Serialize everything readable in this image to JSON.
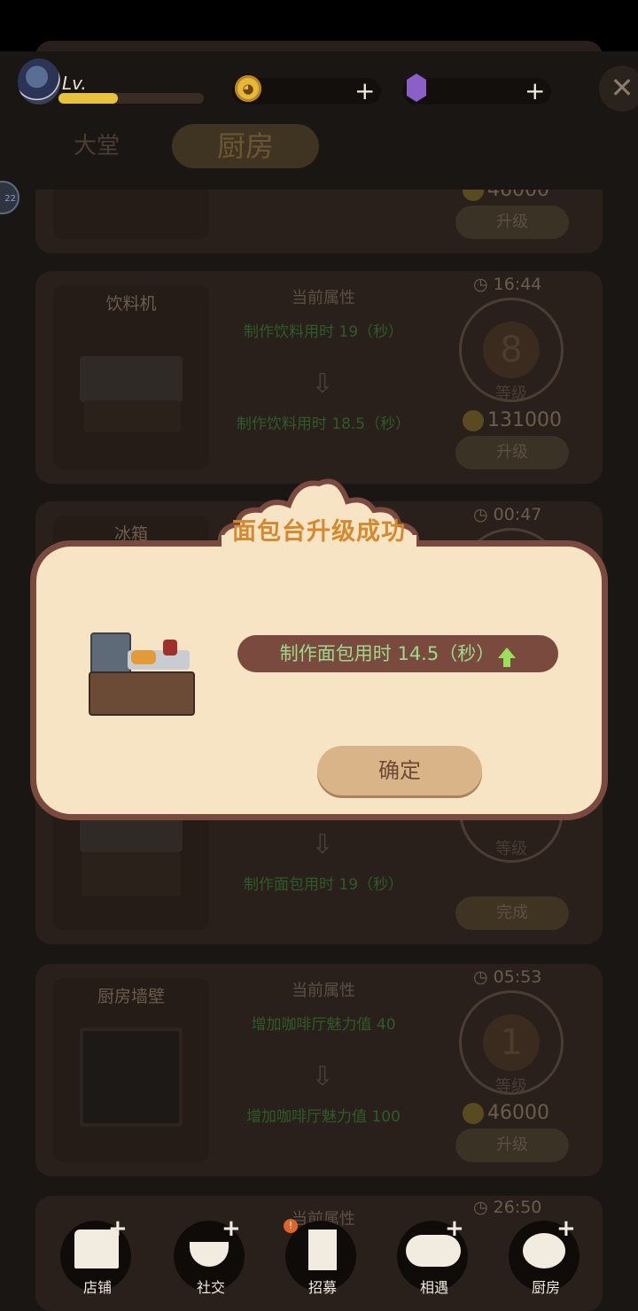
{
  "top_bar": {
    "level_label": "Lv.",
    "xp_progress": 0.41,
    "coin_add": "+",
    "gem_add": "+",
    "close": "✕"
  },
  "tabs": {
    "hall": "大堂",
    "kitchen": "厨房"
  },
  "cards": [
    {
      "title": "",
      "attr_header": "",
      "current": "",
      "next": "",
      "timer": "",
      "level": "",
      "level_word": "",
      "cost": "46000",
      "button": "升级"
    },
    {
      "title": "饮料机",
      "attr_header": "当前属性",
      "current": "制作饮料用时 19（秒）",
      "next": "制作饮料用时 18.5（秒）",
      "timer": "16:44",
      "level": "8",
      "level_word": "等级",
      "cost": "131000",
      "button": "升级"
    },
    {
      "title": "冰箱",
      "timer": "00:47"
    },
    {
      "next": "制作面包用时 19（秒）",
      "level_word": "等级",
      "button": "完成"
    },
    {
      "title": "厨房墙壁",
      "attr_header": "当前属性",
      "current": "增加咖啡厅魅力值 40",
      "next": "增加咖啡厅魅力值 100",
      "timer": "05:53",
      "level": "1",
      "level_word": "等级",
      "cost": "46000",
      "button": "升级"
    },
    {
      "attr_header": "当前属性",
      "timer": "26:50"
    }
  ],
  "dialog": {
    "title": "面包台升级成功",
    "stat": "制作面包用时 14.5（秒）",
    "confirm": "确定"
  },
  "side_badge": "22",
  "nav": [
    {
      "label": "店铺",
      "icon": "shop-icon",
      "plus": "+"
    },
    {
      "label": "社交",
      "icon": "coffee-cup-icon",
      "plus": "+"
    },
    {
      "label": "招募",
      "icon": "recruit-door-icon",
      "badge": "!"
    },
    {
      "label": "相遇",
      "icon": "handshake-icon",
      "plus": "+"
    },
    {
      "label": "厨房",
      "icon": "frying-pan-icon",
      "plus": "+"
    }
  ],
  "colors": {
    "dialog_bg": "#f6e4c4",
    "dialog_border": "#7a4a3e",
    "title_orange": "#d4892f",
    "stat_green": "#9ed98e",
    "confirm_bg": "#d9b488"
  }
}
